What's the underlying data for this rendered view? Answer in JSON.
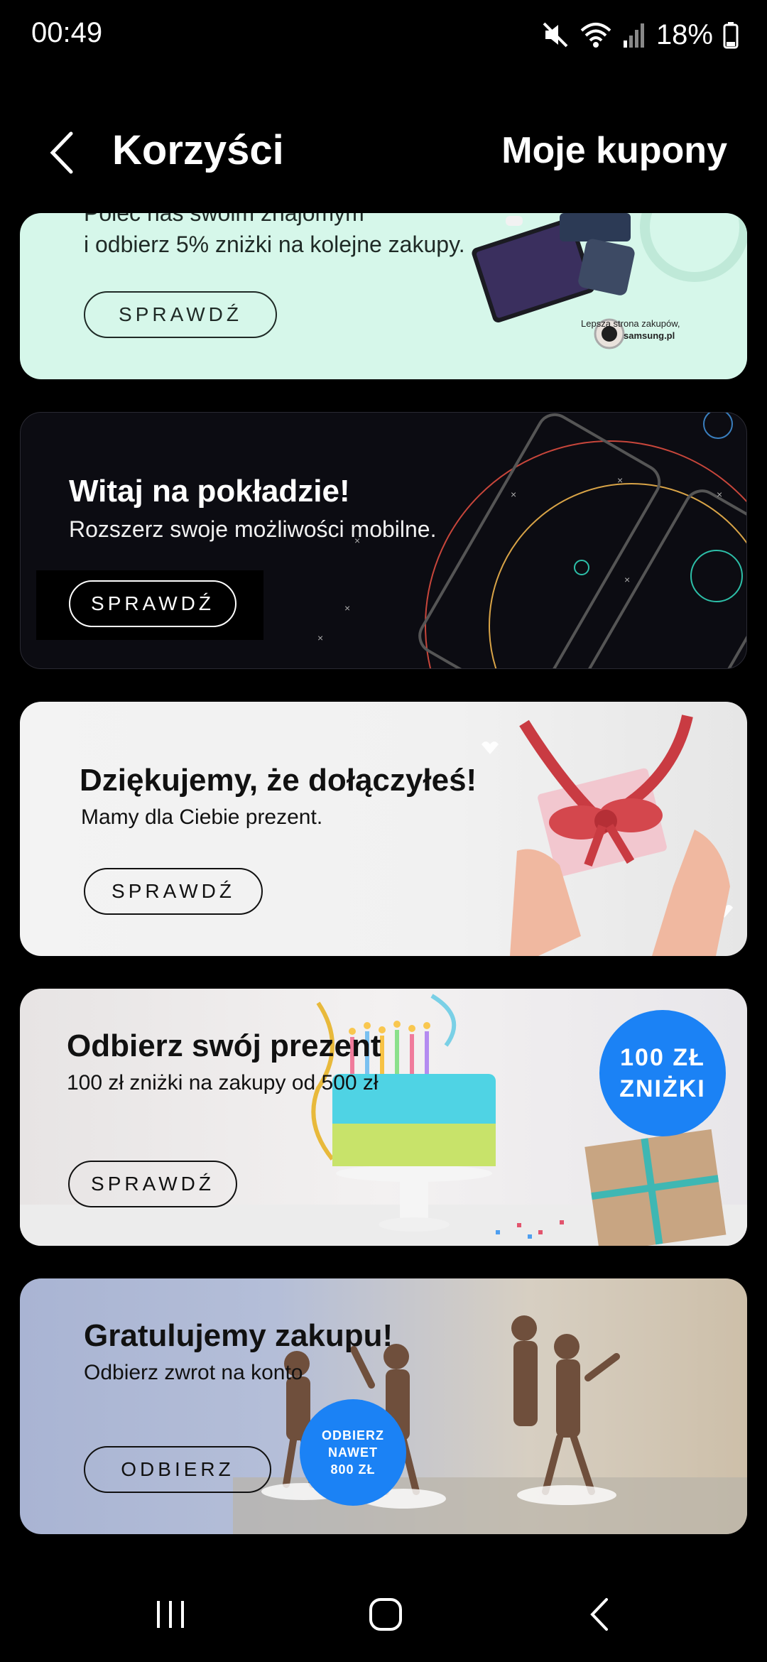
{
  "status_bar": {
    "time": "00:49",
    "battery": "18%"
  },
  "header": {
    "title": "Korzyści",
    "coupons_link": "Moje kupony"
  },
  "cards": [
    {
      "subtitle_line1": "Poleć nas swoim znajomym",
      "subtitle_line2": "i odbierz  5% zniżki na kolejne zakupy.",
      "button": "SPRAWDŹ",
      "small_text_1": "Lepsza strona zakupów,",
      "small_text_2": "samsung.pl"
    },
    {
      "title": "Witaj na pokładzie!",
      "subtitle": "Rozszerz swoje możliwości mobilne.",
      "button": "SPRAWDŹ"
    },
    {
      "title": "Dziękujemy, że dołączyłeś!",
      "subtitle": "Mamy dla Ciebie prezent.",
      "button": "SPRAWDŹ"
    },
    {
      "title": "Odbierz swój prezent",
      "subtitle": "100 zł zniżki na zakupy od 500 zł",
      "button": "SPRAWDŹ",
      "badge_line1": "100 ZŁ",
      "badge_line2": "ZNIŻKI"
    },
    {
      "title": "Gratulujemy zakupu!",
      "subtitle": "Odbierz zwrot na konto",
      "button": "ODBIERZ",
      "badge_line1": "ODBIERZ",
      "badge_line2": "NAWET",
      "badge_line3": "800 ZŁ"
    }
  ],
  "colors": {
    "badge_blue": "#1b82f5",
    "card1_bg": "#d6f7ea"
  }
}
